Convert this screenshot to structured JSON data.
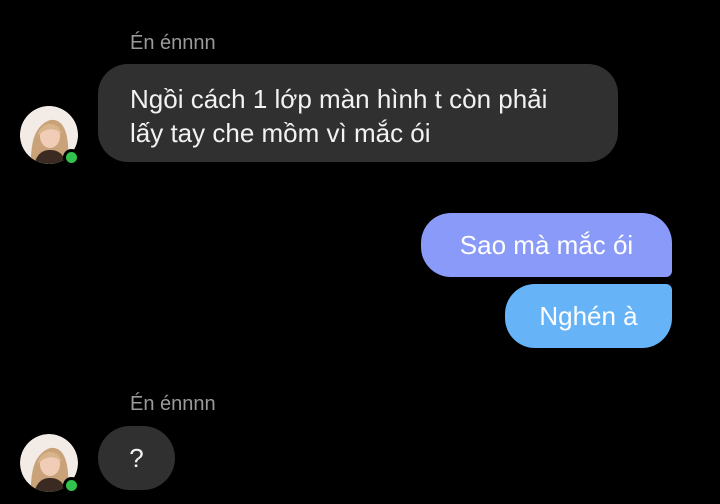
{
  "messages": [
    {
      "sender": "Én énnnn",
      "text_line1": "Ngồi cách 1 lớp màn hình t còn phải",
      "text_line2": "lấy tay che mồm vì mắc ói"
    },
    {
      "text": "Sao mà mắc ói"
    },
    {
      "text": "Nghén à"
    },
    {
      "sender": "Én énnnn",
      "text": "?"
    }
  ],
  "colors": {
    "background": "#000000",
    "incoming_bubble": "#303030",
    "outgoing_bubble_top": "#8a9af8",
    "outgoing_bubble_bottom": "#66b3f8",
    "online_status": "#33c24d",
    "sender_name": "#9a9a9a"
  },
  "icons": {
    "avatar": "profile-photo",
    "status": "online-status-dot"
  }
}
